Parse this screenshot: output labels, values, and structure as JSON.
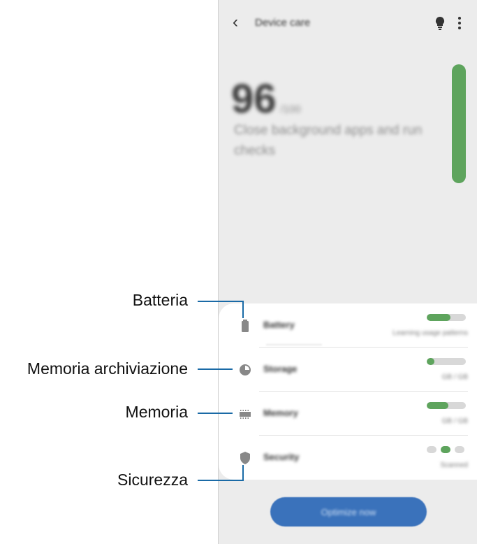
{
  "header": {
    "title": "Device care",
    "back_icon": "back-arrow-icon",
    "tips_icon": "lightbulb-icon",
    "more_icon": "more-options-icon"
  },
  "score": {
    "value": "96",
    "unit": "/100",
    "message": "Close background apps and run checks"
  },
  "items": [
    {
      "label": "Battery",
      "status": "Learning usage patterns",
      "icon": "battery-icon",
      "level": 0.6
    },
    {
      "label": "Storage",
      "status": "GB / GB",
      "icon": "pie-chart-icon",
      "level": 0.2
    },
    {
      "label": "Memory",
      "status": "GB / GB",
      "icon": "memory-chip-icon",
      "level": 0.55
    },
    {
      "label": "Security",
      "status": "Scanned",
      "icon": "shield-icon"
    }
  ],
  "button": {
    "label": "Optimize now"
  },
  "callouts": {
    "battery": "Batteria",
    "storage": "Memoria archiviazione",
    "memory": "Memoria",
    "security": "Sicurezza"
  },
  "colors": {
    "accent_green": "#5ea45d",
    "button_blue": "#3a72bb",
    "callout_line": "#1a6aa6"
  }
}
